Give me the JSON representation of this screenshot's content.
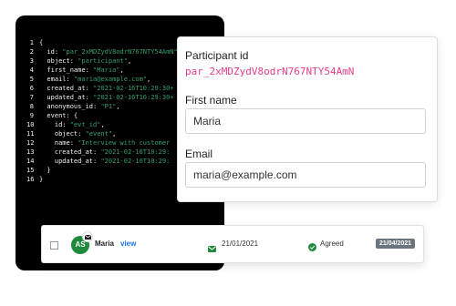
{
  "code": {
    "lines": [
      {
        "n": "1",
        "parts": [
          {
            "t": "{",
            "c": "plain"
          }
        ]
      },
      {
        "n": "2",
        "parts": [
          {
            "t": "  id: ",
            "c": "plain"
          },
          {
            "t": "\"par_2xMDZydV8odrN767NTY54AmN\"",
            "c": "str"
          }
        ]
      },
      {
        "n": "3",
        "parts": [
          {
            "t": "  object: ",
            "c": "plain"
          },
          {
            "t": "\"participant\"",
            "c": "str"
          },
          {
            "t": ",",
            "c": "plain"
          }
        ]
      },
      {
        "n": "4",
        "parts": [
          {
            "t": "  first_name: ",
            "c": "plain"
          },
          {
            "t": "\"Maria\"",
            "c": "str"
          },
          {
            "t": ",",
            "c": "plain"
          }
        ]
      },
      {
        "n": "5",
        "parts": [
          {
            "t": "  email: ",
            "c": "plain"
          },
          {
            "t": "\"maria@example.com\"",
            "c": "str"
          },
          {
            "t": ",",
            "c": "plain"
          }
        ]
      },
      {
        "n": "6",
        "parts": [
          {
            "t": "  created_at: ",
            "c": "plain"
          },
          {
            "t": "\"2021-02-16T10:29:30+",
            "c": "str"
          }
        ]
      },
      {
        "n": "7",
        "parts": [
          {
            "t": "  updated_at: ",
            "c": "plain"
          },
          {
            "t": "\"2021-02-16T10:29:30+",
            "c": "str"
          }
        ]
      },
      {
        "n": "8",
        "parts": [
          {
            "t": "  anonymous_id: ",
            "c": "plain"
          },
          {
            "t": "\"P1\"",
            "c": "str"
          },
          {
            "t": ",",
            "c": "plain"
          }
        ]
      },
      {
        "n": "9",
        "parts": [
          {
            "t": "  event: {",
            "c": "plain"
          }
        ]
      },
      {
        "n": "10",
        "parts": [
          {
            "t": "    id: ",
            "c": "plain"
          },
          {
            "t": "\"evt_id\"",
            "c": "str"
          },
          {
            "t": ",",
            "c": "plain"
          }
        ]
      },
      {
        "n": "11",
        "parts": [
          {
            "t": "    object: ",
            "c": "plain"
          },
          {
            "t": "\"event\"",
            "c": "str"
          },
          {
            "t": ",",
            "c": "plain"
          }
        ]
      },
      {
        "n": "12",
        "parts": [
          {
            "t": "    name: ",
            "c": "plain"
          },
          {
            "t": "\"Interview with customer",
            "c": "str"
          }
        ]
      },
      {
        "n": "13",
        "parts": [
          {
            "t": "    created_at: ",
            "c": "plain"
          },
          {
            "t": "\"2021-02-16T10:29:",
            "c": "str"
          }
        ]
      },
      {
        "n": "14",
        "parts": [
          {
            "t": "    updated_at: ",
            "c": "plain"
          },
          {
            "t": "\"2021-02-16T10:29:",
            "c": "str"
          }
        ]
      },
      {
        "n": "15",
        "parts": [
          {
            "t": "  }",
            "c": "plain"
          }
        ]
      },
      {
        "n": "16",
        "parts": [
          {
            "t": "}",
            "c": "plain"
          }
        ]
      }
    ]
  },
  "participant_card": {
    "id_label": "Participant id",
    "id_value": "par_2xMDZydV8odrN767NTY54AmN",
    "first_name_label": "First name",
    "first_name_value": "Maria",
    "email_label": "Email",
    "email_value": "maria@example.com"
  },
  "row": {
    "avatar_initials": "AS",
    "name": "Maria",
    "view_label": "view",
    "invite_date": "21/01/2021",
    "status": "Agreed",
    "date_badge": "21/04/2021"
  },
  "colors": {
    "accent_pink": "#e83e8c",
    "code_string": "#34a06e",
    "avatar_green": "#1e8a3c",
    "link_blue": "#1a73e8",
    "badge_gray": "#6c757d"
  },
  "icons": {
    "mail": "mail-icon",
    "check": "check-circle-icon",
    "avatar_badge": "envelope-badge-icon"
  }
}
